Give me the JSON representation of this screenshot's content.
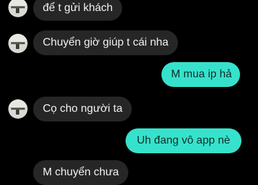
{
  "conversation": {
    "messages": [
      {
        "side": "incoming",
        "text": "để t gửi khách"
      },
      {
        "side": "incoming",
        "text": "Chuyển giờ giúp t cái nha"
      },
      {
        "side": "outgoing",
        "text": "M mua ip hả"
      },
      {
        "side": "incoming",
        "text": "Cọ cho người ta"
      },
      {
        "side": "outgoing",
        "text": "Uh đang vô app nè"
      },
      {
        "side": "incoming",
        "text": "M chuyển chưa"
      }
    ]
  },
  "colors": {
    "background": "#000000",
    "incoming_bubble": "#262626",
    "incoming_text": "#f2f2f2",
    "outgoing_bubble": "#36e2cc",
    "outgoing_text": "#0e2e2a"
  },
  "icons": {
    "avatar": "contact-avatar-icon"
  }
}
